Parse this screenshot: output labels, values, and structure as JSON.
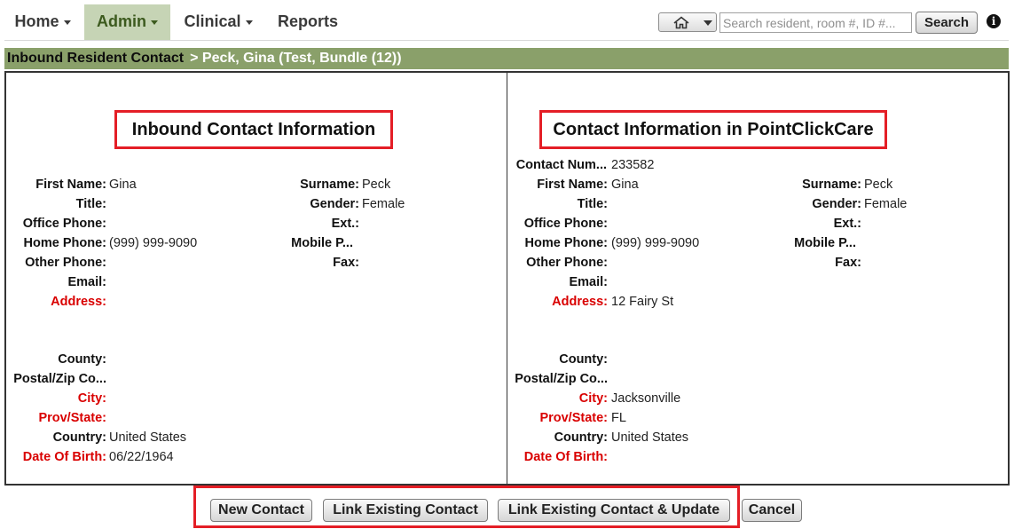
{
  "nav": {
    "home": "Home",
    "admin": "Admin",
    "clinical": "Clinical",
    "reports": "Reports",
    "search_placeholder": "Search resident, room #, ID #...",
    "search_button": "Search",
    "info": "i"
  },
  "titlebar": {
    "section": "Inbound Resident Contact",
    "resident": "> Peck, Gina (Test, Bundle (12))"
  },
  "inbound": {
    "heading": "Inbound Contact Information",
    "labels": {
      "first_name": "First Name:",
      "surname": "Surname:",
      "title": "Title:",
      "gender": "Gender:",
      "office_phone": "Office Phone:",
      "ext": "Ext.:",
      "home_phone": "Home Phone:",
      "mobile_phone": "Mobile P...",
      "other_phone": "Other Phone:",
      "fax": "Fax:",
      "email": "Email:",
      "address": "Address:",
      "county": "County:",
      "postal": "Postal/Zip Co...",
      "city": "City:",
      "prov_state": "Prov/State:",
      "country": "Country:",
      "dob": "Date Of Birth:"
    },
    "values": {
      "first_name": "Gina",
      "surname": "Peck",
      "gender": "Female",
      "home_phone": "(999) 999-9090",
      "country": "United States",
      "dob": "06/22/1964"
    }
  },
  "pcc": {
    "heading": "Contact Information in PointClickCare",
    "labels": {
      "contact_number": "Contact Num...",
      "first_name": "First Name:",
      "surname": "Surname:",
      "title": "Title:",
      "gender": "Gender:",
      "office_phone": "Office Phone:",
      "ext": "Ext.:",
      "home_phone": "Home Phone:",
      "mobile_phone": "Mobile P...",
      "other_phone": "Other Phone:",
      "fax": "Fax:",
      "email": "Email:",
      "address": "Address:",
      "county": "County:",
      "postal": "Postal/Zip Co...",
      "city": "City:",
      "prov_state": "Prov/State:",
      "country": "Country:",
      "dob": "Date Of Birth:"
    },
    "values": {
      "contact_number": "233582",
      "first_name": "Gina",
      "surname": "Peck",
      "gender": "Female",
      "home_phone": "(999) 999-9090",
      "address": "12 Fairy St",
      "city": "Jacksonville",
      "prov_state": "FL",
      "country": "United States"
    }
  },
  "actions": {
    "new_contact": "New Contact",
    "link_existing": "Link Existing Contact",
    "link_update": "Link Existing Contact & Update",
    "cancel": "Cancel"
  },
  "colors": {
    "accent_green": "#8aa06a",
    "active_tab": "#c6d4b5",
    "highlight_red": "#e41e26",
    "required_label": "#d90000"
  }
}
